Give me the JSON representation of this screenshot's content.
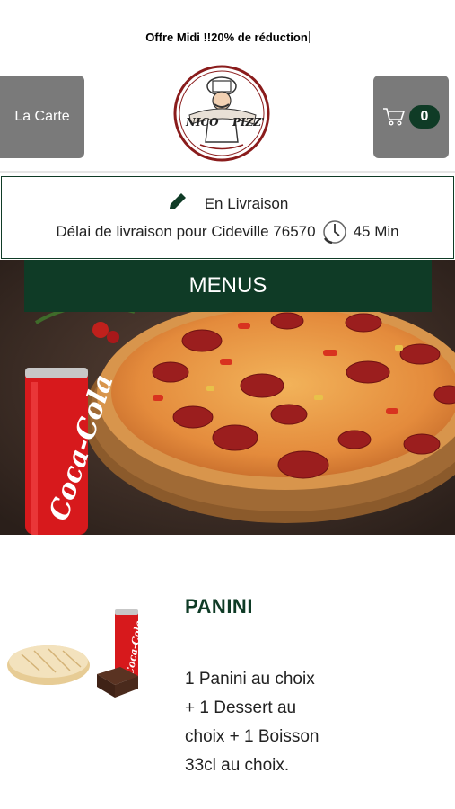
{
  "promo": {
    "text": "Offre Midi !!20% de réduction"
  },
  "header": {
    "menu_button_label": "La Carte",
    "cart_count": "0",
    "logo_text_left": "NICO",
    "logo_text_right": "PIZZ'"
  },
  "delivery": {
    "mode_label": "En Livraison",
    "delay_text": "Délai de livraison pour Cideville 76570",
    "delay_value": "45 Min"
  },
  "hero": {
    "category_label": "MENUS",
    "can_text": "Coca-Cola"
  },
  "menu_item": {
    "title": "PANINI",
    "description": "1 Panini au choix\n+ 1 Dessert au\nchoix   + 1 Boisson\n33cl au choix.",
    "can_text": "Coca-Cola"
  },
  "colors": {
    "brand_green": "#0f3b26",
    "button_gray": "#7a7a7a",
    "coke_red": "#d7191c"
  },
  "icons": [
    "pencil-icon",
    "clock-icon",
    "cart-icon"
  ]
}
